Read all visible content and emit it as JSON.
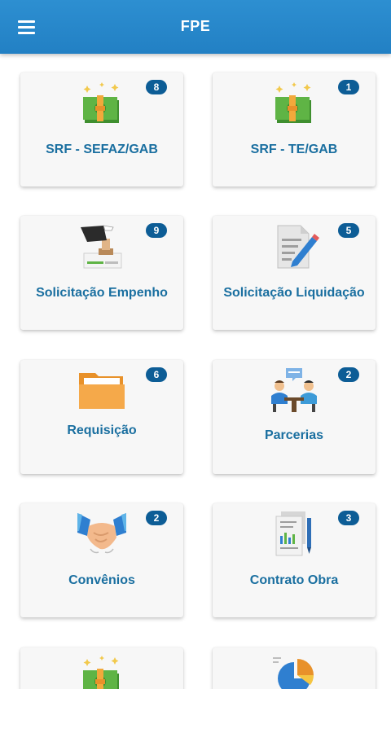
{
  "appbar": {
    "title": "FPE"
  },
  "cards": [
    {
      "label": "SRF - SEFAZ/GAB",
      "badge": "8",
      "icon": "money-icon"
    },
    {
      "label": "SRF - TE/GAB",
      "badge": "1",
      "icon": "money-icon"
    },
    {
      "label": "Solicitação Empenho",
      "badge": "9",
      "icon": "stamp-icon"
    },
    {
      "label": "Solicitação Liquidação",
      "badge": "5",
      "icon": "document-pencil-icon"
    },
    {
      "label": "Requisição",
      "badge": "6",
      "icon": "folder-icon"
    },
    {
      "label": "Parcerias",
      "badge": "2",
      "icon": "meeting-icon"
    },
    {
      "label": "Convênios",
      "badge": "2",
      "icon": "handshake-icon"
    },
    {
      "label": "Contrato Obra",
      "badge": "3",
      "icon": "contract-icon"
    },
    {
      "label": "",
      "badge": "",
      "icon": "money-icon"
    },
    {
      "label": "",
      "badge": "",
      "icon": "pie-chart-icon"
    }
  ],
  "colors": {
    "appbar": "#2d8fd1",
    "label": "#1a6fa0",
    "badge": "#0d5d96"
  }
}
